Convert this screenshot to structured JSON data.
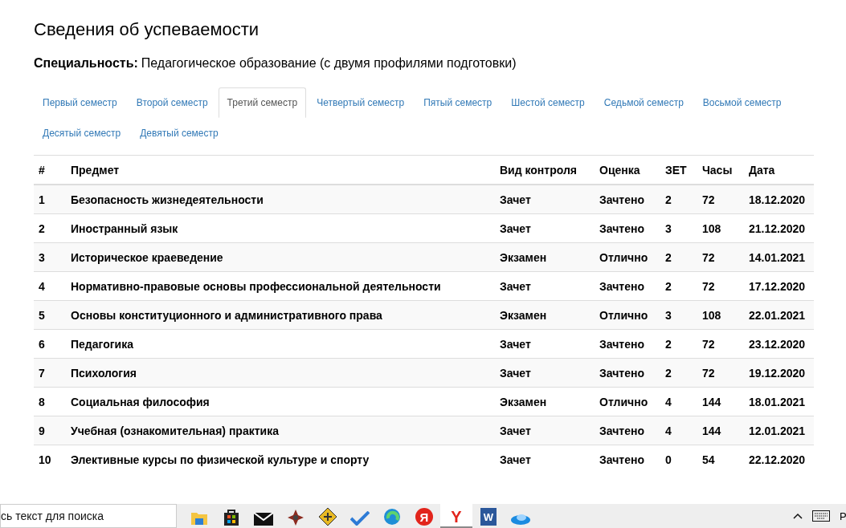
{
  "page": {
    "title": "Сведения об успеваемости",
    "specialty_label": "Специальность:",
    "specialty_value": "Педагогическое образование (с двумя профилями подготовки)"
  },
  "tabs": [
    {
      "label": "Первый семестр",
      "selected": false
    },
    {
      "label": "Второй семестр",
      "selected": false
    },
    {
      "label": "Третий семестр",
      "selected": true
    },
    {
      "label": "Четвертый семестр",
      "selected": false
    },
    {
      "label": "Пятый семестр",
      "selected": false
    },
    {
      "label": "Шестой семестр",
      "selected": false
    },
    {
      "label": "Седьмой семестр",
      "selected": false
    },
    {
      "label": "Восьмой семестр",
      "selected": false
    },
    {
      "label": "Десятый семестр",
      "selected": false
    },
    {
      "label": "Девятый семестр",
      "selected": false
    }
  ],
  "table": {
    "columns": [
      "#",
      "Предмет",
      "Вид контроля",
      "Оценка",
      "ЗЕТ",
      "Часы",
      "Дата"
    ],
    "rows": [
      [
        "1",
        "Безопасность жизнедеятельности",
        "Зачет",
        "Зачтено",
        "2",
        "72",
        "18.12.2020"
      ],
      [
        "2",
        "Иностранный язык",
        "Зачет",
        "Зачтено",
        "3",
        "108",
        "21.12.2020"
      ],
      [
        "3",
        "Историческое краеведение",
        "Экзамен",
        "Отлично",
        "2",
        "72",
        "14.01.2021"
      ],
      [
        "4",
        "Нормативно-правовые основы профессиональной деятельности",
        "Зачет",
        "Зачтено",
        "2",
        "72",
        "17.12.2020"
      ],
      [
        "5",
        "Основы конституционного и административного права",
        "Экзамен",
        "Отлично",
        "3",
        "108",
        "22.01.2021"
      ],
      [
        "6",
        "Педагогика",
        "Зачет",
        "Зачтено",
        "2",
        "72",
        "23.12.2020"
      ],
      [
        "7",
        "Психология",
        "Зачет",
        "Зачтено",
        "2",
        "72",
        "19.12.2020"
      ],
      [
        "8",
        "Социальная философия",
        "Экзамен",
        "Отлично",
        "4",
        "144",
        "18.01.2021"
      ],
      [
        "9",
        "Учебная (ознакомительная) практика",
        "Зачет",
        "Зачтено",
        "4",
        "144",
        "12.01.2021"
      ],
      [
        "10",
        "Элективные курсы по физической культуре и спорту",
        "Зачет",
        "Зачтено",
        "0",
        "54",
        "22.12.2020"
      ]
    ]
  },
  "taskbar": {
    "search_text": "сь текст для поиска",
    "apps": [
      {
        "kind": "folder",
        "selected": false
      },
      {
        "kind": "store",
        "selected": false
      },
      {
        "kind": "mail",
        "selected": false
      },
      {
        "kind": "star",
        "selected": false
      },
      {
        "kind": "diamond",
        "selected": false
      },
      {
        "kind": "check",
        "selected": false
      },
      {
        "kind": "swirl",
        "selected": false
      },
      {
        "kind": "circle-letter",
        "glyph": "Я",
        "selected": false
      },
      {
        "kind": "letter",
        "glyph": "Y",
        "selected": true
      },
      {
        "kind": "doc",
        "glyph": "W",
        "selected": false
      },
      {
        "kind": "cloud",
        "selected": false
      }
    ],
    "tray_text": "Р"
  }
}
